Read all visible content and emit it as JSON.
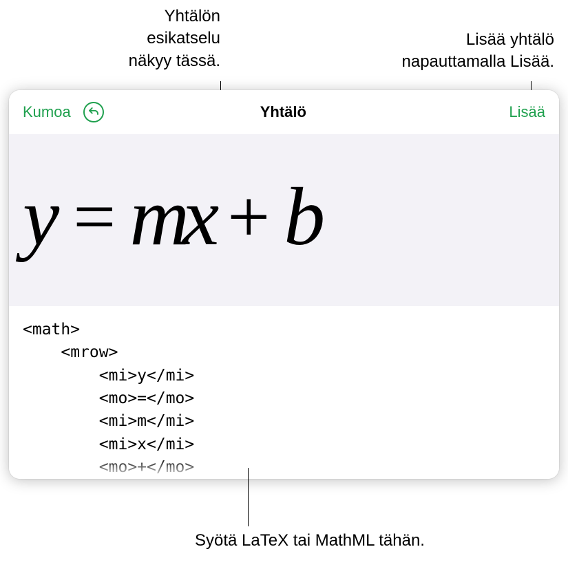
{
  "callouts": {
    "preview": "Yhtälön\nesikatselu\nnäkyy tässä.",
    "insert": "Lisää yhtälö\nnapauttamalla Lisää.",
    "input": "Syötä LaTeX tai MathML tähän."
  },
  "toolbar": {
    "cancel_label": "Kumoa",
    "undo_icon_name": "undo-icon",
    "title": "Yhtälö",
    "insert_label": "Lisää"
  },
  "equation_preview": {
    "y": "y",
    "eq": "=",
    "mx": "mx",
    "plus": "+",
    "b": "b"
  },
  "code": "<math>\n    <mrow>\n        <mi>y</mi>\n        <mo>=</mo>\n        <mi>m</mi>\n        <mi>x</mi>\n        <mo>+</mo>\n        <mi>b</mi>"
}
